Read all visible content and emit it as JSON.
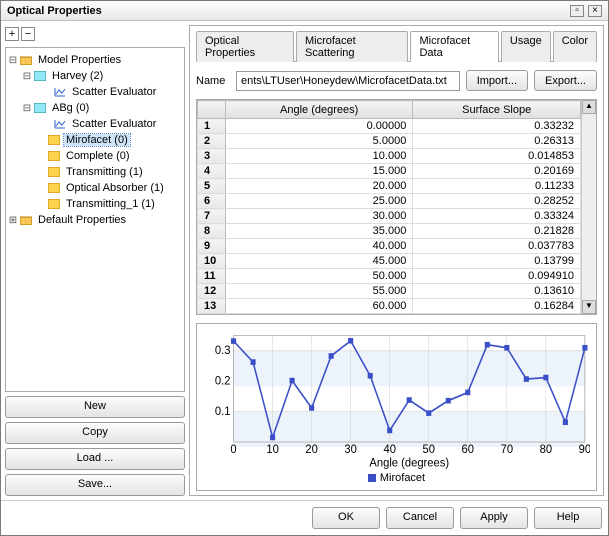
{
  "window": {
    "title": "Optical Properties"
  },
  "tree_toolbar": {
    "expand": "+",
    "collapse": "−"
  },
  "tree": {
    "model": {
      "label": "Model Properties",
      "children": {
        "harvey": {
          "label": "Harvey (2)",
          "se": "Scatter Evaluator"
        },
        "abg": {
          "label": "ABg (0)",
          "se": "Scatter Evaluator"
        },
        "mirofacet": {
          "label": "Mirofacet (0)"
        },
        "complete": {
          "label": "Complete (0)"
        },
        "transmitting": {
          "label": "Transmitting (1)"
        },
        "opticalabsorber": {
          "label": "Optical Absorber (1)"
        },
        "transmitting1": {
          "label": "Transmitting_1 (1)"
        }
      }
    },
    "default": {
      "label": "Default Properties"
    }
  },
  "left_buttons": {
    "new": "New",
    "copy": "Copy",
    "load": "Load ...",
    "save": "Save..."
  },
  "tabs": {
    "op": "Optical Properties",
    "ms": "Microfacet Scattering",
    "md": "Microfacet Data",
    "usage": "Usage",
    "color": "Color"
  },
  "name_row": {
    "label": "Name",
    "value": "ents\\LTUser\\Honeydew\\MicrofacetData.txt",
    "import": "Import...",
    "export": "Export..."
  },
  "table": {
    "head": {
      "index": "",
      "angle": "Angle (degrees)",
      "slope": "Surface Slope"
    },
    "rows": [
      {
        "n": "1",
        "angle": "0.00000",
        "slope": "0.33232"
      },
      {
        "n": "2",
        "angle": "5.0000",
        "slope": "0.26313"
      },
      {
        "n": "3",
        "angle": "10.000",
        "slope": "0.014853"
      },
      {
        "n": "4",
        "angle": "15.000",
        "slope": "0.20169"
      },
      {
        "n": "5",
        "angle": "20.000",
        "slope": "0.11233"
      },
      {
        "n": "6",
        "angle": "25.000",
        "slope": "0.28252"
      },
      {
        "n": "7",
        "angle": "30.000",
        "slope": "0.33324"
      },
      {
        "n": "8",
        "angle": "35.000",
        "slope": "0.21828"
      },
      {
        "n": "9",
        "angle": "40.000",
        "slope": "0.037783"
      },
      {
        "n": "10",
        "angle": "45.000",
        "slope": "0.13799"
      },
      {
        "n": "11",
        "angle": "50.000",
        "slope": "0.094910"
      },
      {
        "n": "12",
        "angle": "55.000",
        "slope": "0.13610"
      },
      {
        "n": "13",
        "angle": "60.000",
        "slope": "0.16284"
      }
    ]
  },
  "chart_data": {
    "type": "line",
    "title": "",
    "xlabel": "Angle (degrees)",
    "ylabel": "",
    "xlim": [
      0,
      90
    ],
    "ylim": [
      0,
      0.35
    ],
    "xticks": [
      0,
      10,
      20,
      30,
      40,
      50,
      60,
      70,
      80,
      90
    ],
    "yticks": [
      0.1,
      0.2,
      0.3
    ],
    "series": [
      {
        "name": "Mirofacet",
        "x": [
          0,
          5,
          10,
          15,
          20,
          25,
          30,
          35,
          40,
          45,
          50,
          55,
          60,
          65,
          70,
          75,
          80,
          85,
          90
        ],
        "y": [
          0.332,
          0.263,
          0.015,
          0.202,
          0.112,
          0.283,
          0.333,
          0.218,
          0.038,
          0.138,
          0.095,
          0.136,
          0.163,
          0.32,
          0.31,
          0.207,
          0.212,
          0.065,
          0.31
        ]
      }
    ]
  },
  "chart_legend": {
    "name": "Mirofacet"
  },
  "dialog_buttons": {
    "ok": "OK",
    "cancel": "Cancel",
    "apply": "Apply",
    "help": "Help"
  }
}
